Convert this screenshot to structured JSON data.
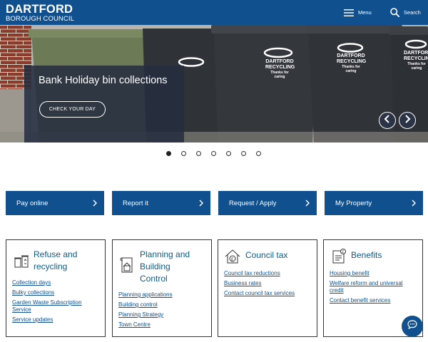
{
  "header": {
    "logo_top": "DARTFORD",
    "logo_bottom": "BOROUGH COUNCIL",
    "menu_label": "Menu",
    "search_label": "Search",
    "colors": {
      "brand": "#10508e"
    }
  },
  "hero": {
    "title": "Bank Holiday bin collections",
    "cta": "CHECK YOUR DAY",
    "bin_lettering": {
      "name1": "DARTFORD",
      "name2": "RECYCLING",
      "slogan1": "Thanks for",
      "slogan2": "caring"
    },
    "slide_count": 7,
    "active_slide": 1
  },
  "quick_links": [
    {
      "label": "Pay online"
    },
    {
      "label": "Report it"
    },
    {
      "label": "Request / Apply"
    },
    {
      "label": "My Property"
    }
  ],
  "cards": [
    {
      "icon": "recycling-bins-icon",
      "title_lines": [
        "Refuse and",
        "recycling"
      ],
      "links": [
        {
          "lines": [
            "Collection days"
          ]
        },
        {
          "lines": [
            "Bulky collections"
          ]
        },
        {
          "lines": [
            "Garden Waste Subscription",
            "Service"
          ]
        },
        {
          "lines": [
            "Service updates"
          ]
        }
      ]
    },
    {
      "icon": "building-plans-icon",
      "title_lines": [
        "Planning and",
        "Building",
        "Control"
      ],
      "links": [
        {
          "lines": [
            "Planning applications"
          ]
        },
        {
          "lines": [
            "Building control"
          ]
        },
        {
          "lines": [
            "Planning Strategy"
          ]
        },
        {
          "lines": [
            "Town Centre"
          ]
        }
      ]
    },
    {
      "icon": "house-pound-icon",
      "title_lines": [
        "Council tax"
      ],
      "links": [
        {
          "lines": [
            "Council tax reductions"
          ]
        },
        {
          "lines": [
            "Business rates"
          ]
        },
        {
          "lines": [
            "Contact council tax services"
          ]
        }
      ]
    },
    {
      "icon": "benefits-document-icon",
      "title_lines": [
        "Benefits"
      ],
      "links": [
        {
          "lines": [
            "Housing benefit"
          ]
        },
        {
          "lines": [
            "Welfare reform and universal",
            "credit"
          ]
        },
        {
          "lines": [
            "Contact benefit services"
          ]
        }
      ]
    }
  ]
}
